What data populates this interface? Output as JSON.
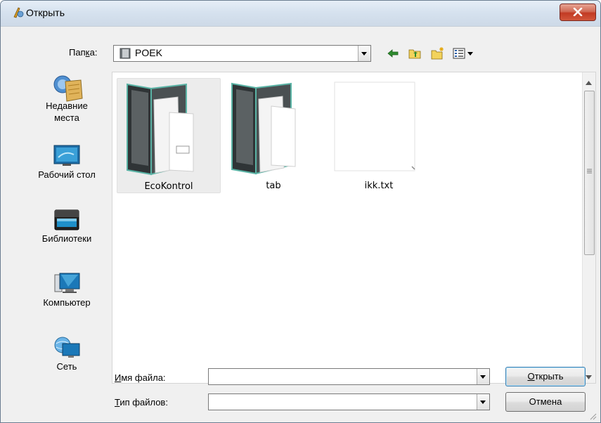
{
  "window": {
    "title": "Открыть",
    "close_icon": "close-icon"
  },
  "toolbar": {
    "folder_label_pre": "Пап",
    "folder_label_hot": "к",
    "folder_label_post": "а:",
    "folder_value": "POEK",
    "icons": [
      "back-arrow-icon",
      "up-folder-icon",
      "new-folder-icon",
      "view-menu-icon"
    ]
  },
  "places": [
    {
      "label_line1": "Недавние",
      "label_line2": "места",
      "icon": "recent-places-icon"
    },
    {
      "label_line1": "Рабочий стол",
      "label_line2": "",
      "icon": "desktop-icon"
    },
    {
      "label_line1": "Библиотеки",
      "label_line2": "",
      "icon": "libraries-icon"
    },
    {
      "label_line1": "Компьютер",
      "label_line2": "",
      "icon": "computer-icon"
    },
    {
      "label_line1": "Сеть",
      "label_line2": "",
      "icon": "network-icon"
    }
  ],
  "files": [
    {
      "name": "EcoKontrol",
      "type": "folder",
      "selected": true
    },
    {
      "name": "tab",
      "type": "folder",
      "selected": false
    },
    {
      "name": "ikk.txt",
      "type": "text-file",
      "selected": false
    }
  ],
  "bottom": {
    "filename_label_hot": "И",
    "filename_label_rest": "мя файла:",
    "filename_value": "",
    "filetype_label_hot": "Т",
    "filetype_label_rest": "ип файлов:",
    "filetype_value": "",
    "open_hot": "О",
    "open_rest": "ткрыть",
    "cancel": "Отмена"
  },
  "colors": {
    "close_button": "#c23a23",
    "titlebar": "#d6e2ef",
    "default_button_border": "#3c7fb1"
  }
}
